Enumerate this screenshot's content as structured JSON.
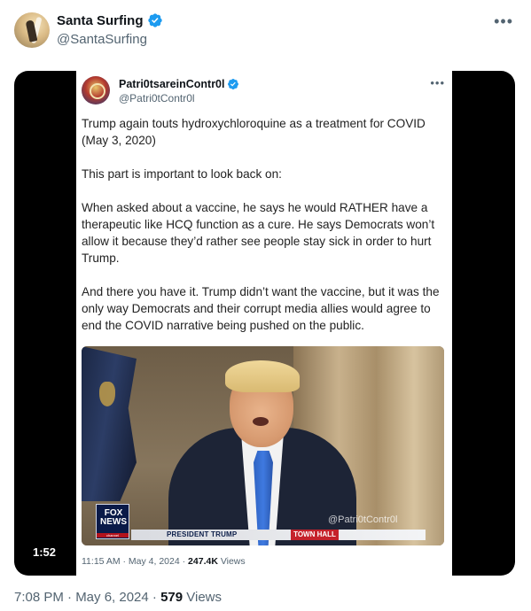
{
  "author": {
    "display_name": "Santa Surfing",
    "handle": "@SantaSurfing",
    "verified": true
  },
  "more_menu_icon": "more-horizontal-icon",
  "media": {
    "duration": "1:52",
    "embedded_post": {
      "display_name": "Patri0tsareinContr0l",
      "handle": "@Patri0tContr0l",
      "verified": true,
      "paragraphs": [
        "Trump again touts hydroxychloroquine as a treatment for COVID (May 3, 2020)",
        "This part is important to look back on:",
        "When asked about a vaccine, he says he would RATHER have a therapeutic like HCQ function as a cure. He says Democrats won’t allow it because they’d rather see people stay sick in order to hurt Trump.",
        "And there you have it. Trump didn’t want the vaccine, but it was the only way Democrats and their corrupt media allies would agree to end the COVID narrative being pushed on the public."
      ],
      "video": {
        "network_logo_line1": "FOX",
        "network_logo_line2": "NEWS",
        "network_logo_sub": "channel",
        "lower_third": "PRESIDENT TRUMP",
        "lower_third_tag": "TOWN HALL",
        "watermark": "@Patri0tContr0l"
      },
      "timestamp": "11:15 AM · May 4, 2024 · ",
      "views_count": "247.4K",
      "views_label": " Views"
    }
  },
  "post_meta": {
    "timestamp": "7:08 PM · May 6, 2024 · ",
    "views_count": "579",
    "views_label": " Views"
  },
  "colors": {
    "verified_blue": "#1d9bf0",
    "secondary_text": "#536471"
  }
}
